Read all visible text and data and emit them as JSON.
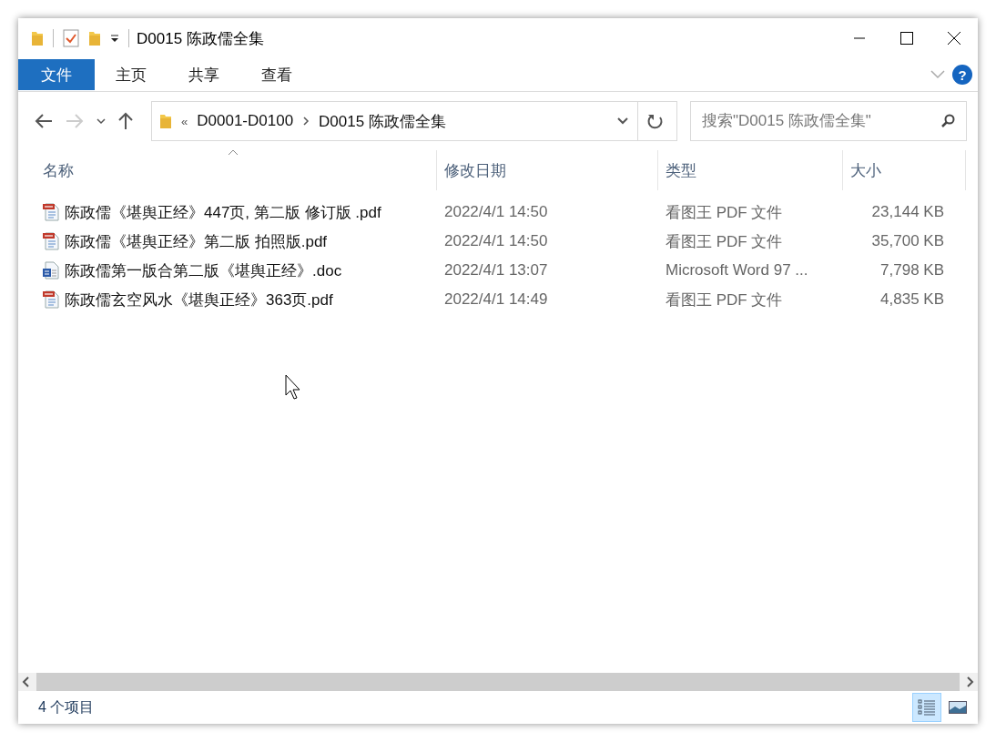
{
  "window": {
    "title": "D0015 陈政儒全集"
  },
  "ribbon_tabs": [
    {
      "label": "文件",
      "kind": "file"
    },
    {
      "label": "主页",
      "kind": "tab"
    },
    {
      "label": "共享",
      "kind": "tab"
    },
    {
      "label": "查看",
      "kind": "tab"
    }
  ],
  "navigation": {
    "back_disabled": false,
    "forward_disabled": true
  },
  "breadcrumb": {
    "overflow": "«",
    "items": [
      "D0001-D0100",
      "D0015 陈政儒全集"
    ]
  },
  "help": {
    "label": "?"
  },
  "search": {
    "placeholder": "搜索\"D0015 陈政儒全集\""
  },
  "columns": [
    {
      "label": "名称",
      "sorted": true
    },
    {
      "label": "修改日期",
      "sorted": false
    },
    {
      "label": "类型",
      "sorted": false
    },
    {
      "label": "大小",
      "sorted": false
    }
  ],
  "files": [
    {
      "kind": "pdf",
      "name": "陈政儒《堪舆正经》447页, 第二版 修订版 .pdf",
      "modified": "2022/4/1 14:50",
      "type": "看图王 PDF 文件",
      "size": "23,144 KB"
    },
    {
      "kind": "pdf",
      "name": "陈政儒《堪舆正经》第二版 拍照版.pdf",
      "modified": "2022/4/1 14:50",
      "type": "看图王 PDF 文件",
      "size": "35,700 KB"
    },
    {
      "kind": "doc",
      "name": "陈政儒第一版合第二版《堪舆正经》.doc",
      "modified": "2022/4/1 13:07",
      "type": "Microsoft Word 97 ...",
      "size": "7,798 KB"
    },
    {
      "kind": "pdf",
      "name": "陈政儒玄空风水《堪舆正经》363页.pdf",
      "modified": "2022/4/1 14:49",
      "type": "看图王 PDF 文件",
      "size": "4,835 KB"
    }
  ],
  "status_bar": {
    "item_count": "4 个项目"
  },
  "view_buttons": [
    {
      "kind": "details",
      "selected": true
    },
    {
      "kind": "large-icons",
      "selected": false
    }
  ]
}
